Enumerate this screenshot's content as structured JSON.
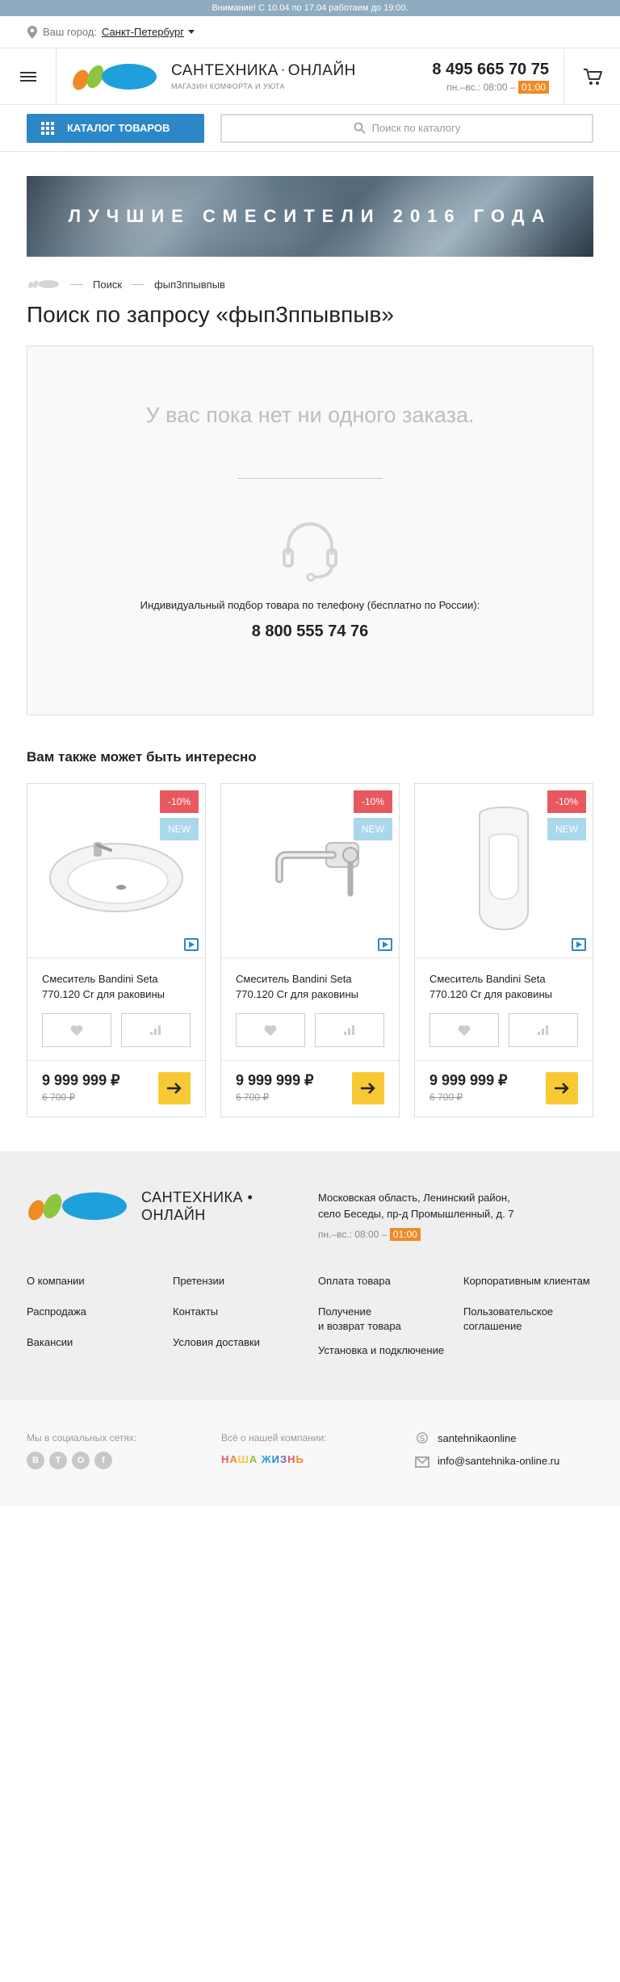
{
  "notice": "Внимание! С 10.04 по 17.04 работаем до 19:00.",
  "city": {
    "label": "Ваш город:",
    "value": "Санкт-Петербург"
  },
  "brand": {
    "name_left": "САНТЕХНИКА",
    "dot": "•",
    "name_right": "ОНЛАЙН",
    "tagline": "МАГАЗИН КОМФОРТА И УЮТА"
  },
  "contact": {
    "phone": "8 495 665 70 75",
    "hours_prefix": "пн.–вс.: 08:00 –",
    "hours_end": "01:00"
  },
  "search": {
    "catalog_label": "КАТАЛОГ ТОВАРОВ",
    "placeholder": "Поиск по каталогу"
  },
  "banner": {
    "text": "ЛУЧШИЕ СМЕСИТЕЛИ 2016 ГОДА"
  },
  "breadcrumb": {
    "items": [
      "Поиск",
      "фып3ппывпыв"
    ]
  },
  "page_title": "Поиск по запросу «фып3ппывпыв»",
  "empty": {
    "message": "У вас пока нет ни одного заказа.",
    "note": "Индивидуальный подбор товара по телефону (бесплатно по России):",
    "phone": "8 800 555 74 76"
  },
  "recommend": {
    "title": "Вам также может быть интересно",
    "products": [
      {
        "badge_sale": "-10%",
        "badge_new": "NEW",
        "name": "Смеситель Bandini Seta 770.120 Cr для раковины",
        "price": "9 999 999 ₽",
        "old_price": "6 700 ₽",
        "image": "washbasin"
      },
      {
        "badge_sale": "-10%",
        "badge_new": "NEW",
        "name": "Смеситель Bandini Seta 770.120 Cr для раковины",
        "price": "9 999 999 ₽",
        "old_price": "6 700 ₽",
        "image": "faucet"
      },
      {
        "badge_sale": "-10%",
        "badge_new": "NEW",
        "name": "Смеситель Bandini Seta 770.120 Cr для раковины",
        "price": "9 999 999 ₽",
        "old_price": "6 700 ₽",
        "image": "urinal"
      }
    ]
  },
  "footer": {
    "brand_line1": "САНТЕХНИКА •",
    "brand_line2": "ОНЛАЙН",
    "address_line1": "Московская область, Ленинский район,",
    "address_line2": "село Беседы, пр-д Промышленный, д. 7",
    "hours_prefix": "пн.–вс.: 08:00 –",
    "hours_end": "01:00",
    "menu": {
      "col1": [
        "О компании",
        "Распродажа",
        "Вакансии"
      ],
      "col2": [
        "Претензии",
        "Контакты",
        "Условия доставки"
      ],
      "col3": [
        "Оплата товара",
        "Получение\nи возврат товара",
        "Установка и подключение"
      ],
      "col4": [
        "Корпоративным клиентам",
        "Пользовательское\nсоглашение"
      ]
    }
  },
  "social": {
    "label": "Мы в социальных сетях:",
    "networks": [
      "В",
      "T",
      "О",
      "f"
    ],
    "company_label": "Всё о нашей компании:",
    "company_link": [
      "Н",
      "А",
      "Ш",
      "А",
      " ",
      "Ж",
      "И",
      "З",
      "Н",
      "Ь"
    ],
    "skype": "santehnikaonline",
    "email": "info@santehnika-online.ru"
  },
  "colors": {
    "accent_blue": "#2c87c7",
    "orange": "#f08a24",
    "sale_red": "#e8585f",
    "new_blue": "#a9d8ec",
    "go_yellow": "#f7c934"
  }
}
